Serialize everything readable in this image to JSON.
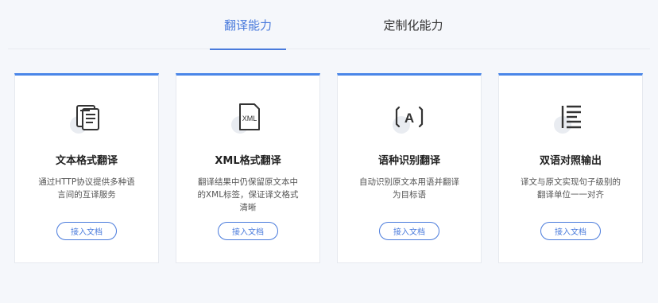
{
  "tabs": [
    {
      "label": "翻译能力",
      "active": true
    },
    {
      "label": "定制化能力",
      "active": false
    }
  ],
  "colors": {
    "accent": "#4a7bdc",
    "card_top_border": "#4a86e8",
    "background": "#f5f7fb"
  },
  "cards": [
    {
      "icon": "document-text-icon",
      "title": "文本格式翻译",
      "desc_lines": [
        "通过HTTP协议提供多种语",
        "言间的互译服务"
      ],
      "button": "接入文档"
    },
    {
      "icon": "xml-file-icon",
      "icon_text": "XML",
      "title": "XML格式翻译",
      "desc_lines": [
        "翻译结果中仍保留原文本中",
        "的XML标签，保证译文格式",
        "清晰"
      ],
      "button": "接入文档"
    },
    {
      "icon": "language-detect-icon",
      "icon_text": "A",
      "title": "语种识别翻译",
      "desc_lines": [
        "自动识别原文本用语并翻译",
        "为目标语"
      ],
      "button": "接入文档"
    },
    {
      "icon": "bilingual-align-icon",
      "title": "双语对照输出",
      "desc_lines": [
        "译文与原文实现句子级别的",
        "翻译单位一一对齐"
      ],
      "button": "接入文档"
    }
  ]
}
